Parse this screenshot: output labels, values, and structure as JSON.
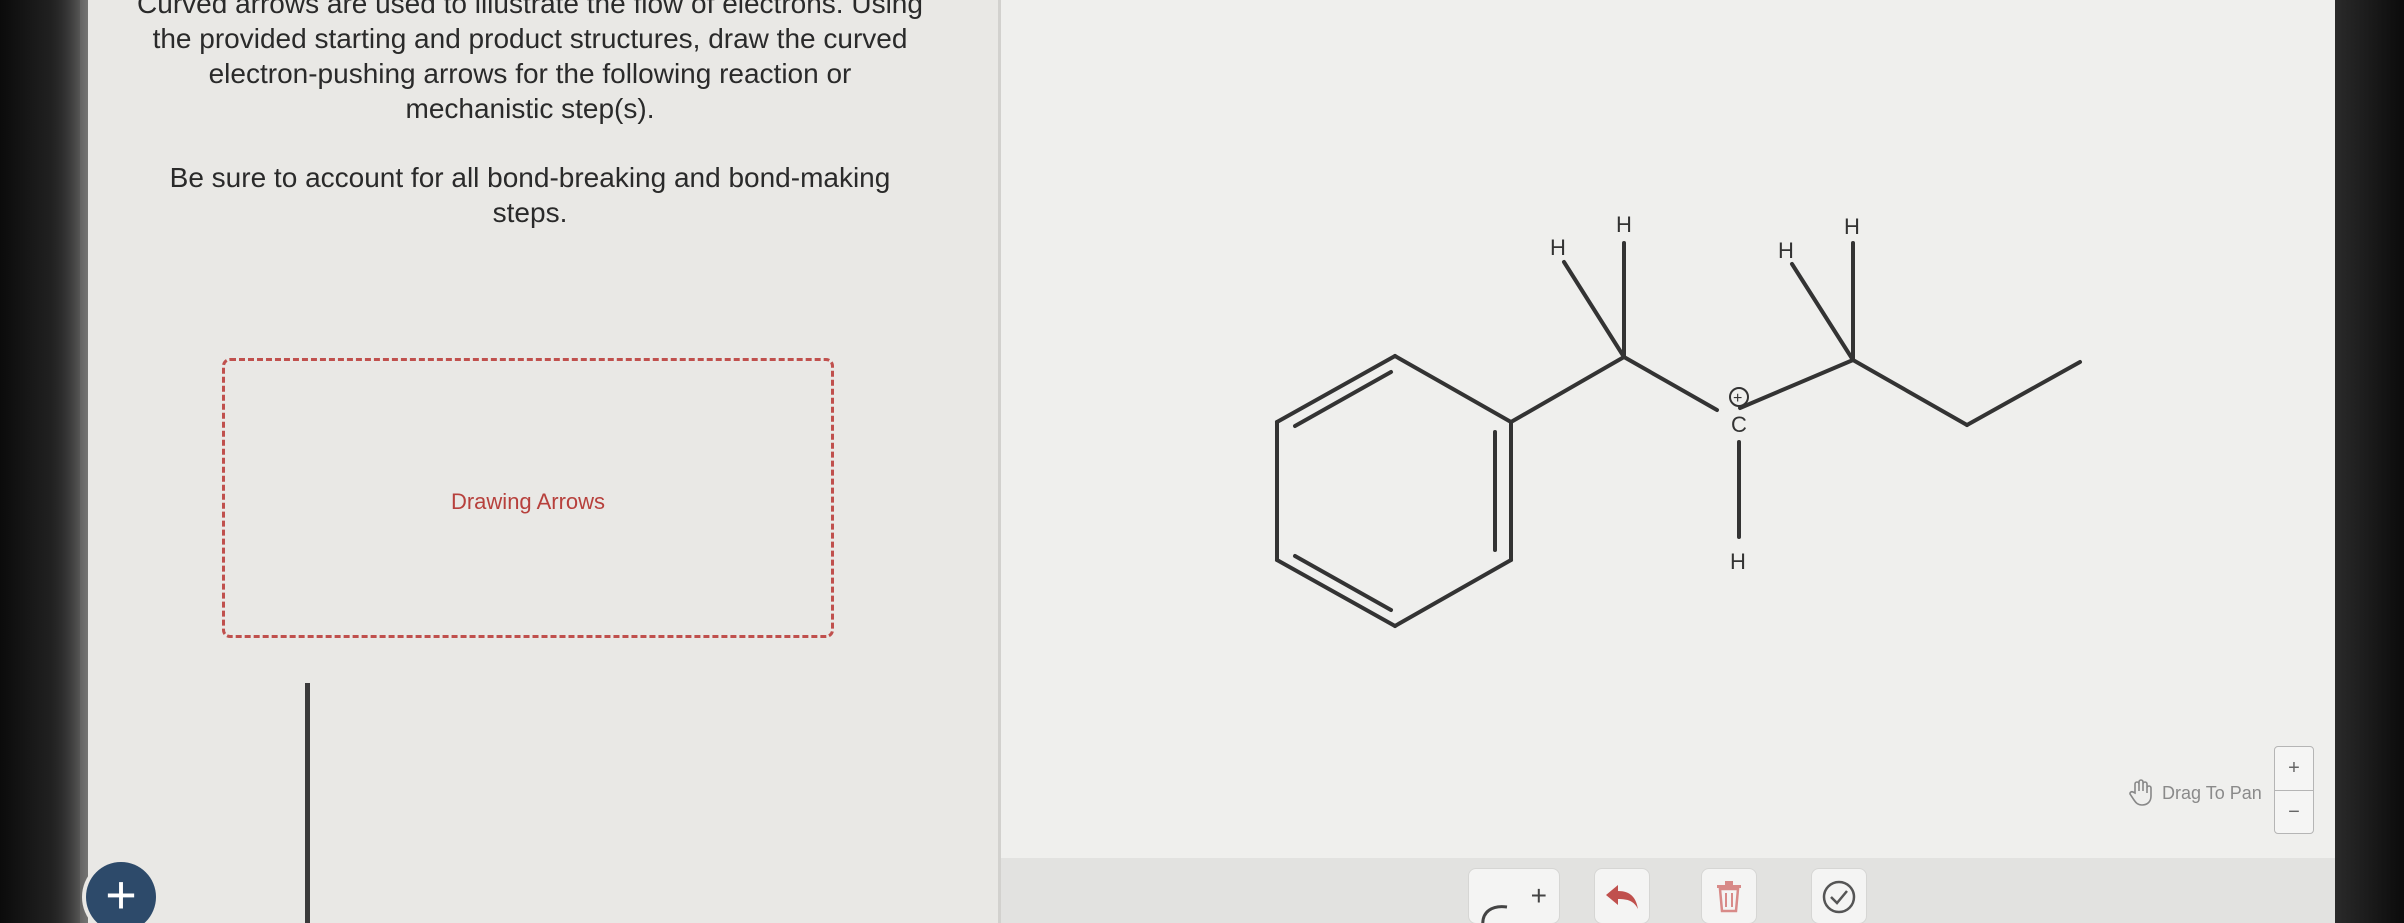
{
  "instructions": {
    "line1": "Curved arrows are used to illustrate the flow of electrons. Using",
    "line2": "the provided starting and product structures, draw the curved",
    "line3": "electron-pushing arrows for the following reaction or",
    "line4": "mechanistic step(s).",
    "line5": "Be sure to account for all bond-breaking and bond-making",
    "line6": "steps."
  },
  "drop_zone": {
    "label": "Drawing Arrows"
  },
  "add_button": {
    "symbol": "+"
  },
  "molecule": {
    "atoms": {
      "h_left_1": "H",
      "h_top_1": "H",
      "h_left_2": "H",
      "h_top_2": "H",
      "carbocation": "C",
      "charge": "+",
      "h_bottom": "H"
    }
  },
  "pan": {
    "label": "Drag To Pan",
    "icon": "hand-icon"
  },
  "zoom": {
    "in": "+",
    "out": "−"
  },
  "toolbar": {
    "add_arrow": "+",
    "undo_icon": "undo-arrow-icon",
    "delete_icon": "trash-icon",
    "check_icon": "check-circle-icon"
  },
  "colors": {
    "accent": "#c0504d",
    "add_button": "#2d4a6a",
    "undo": "#c0504d"
  }
}
